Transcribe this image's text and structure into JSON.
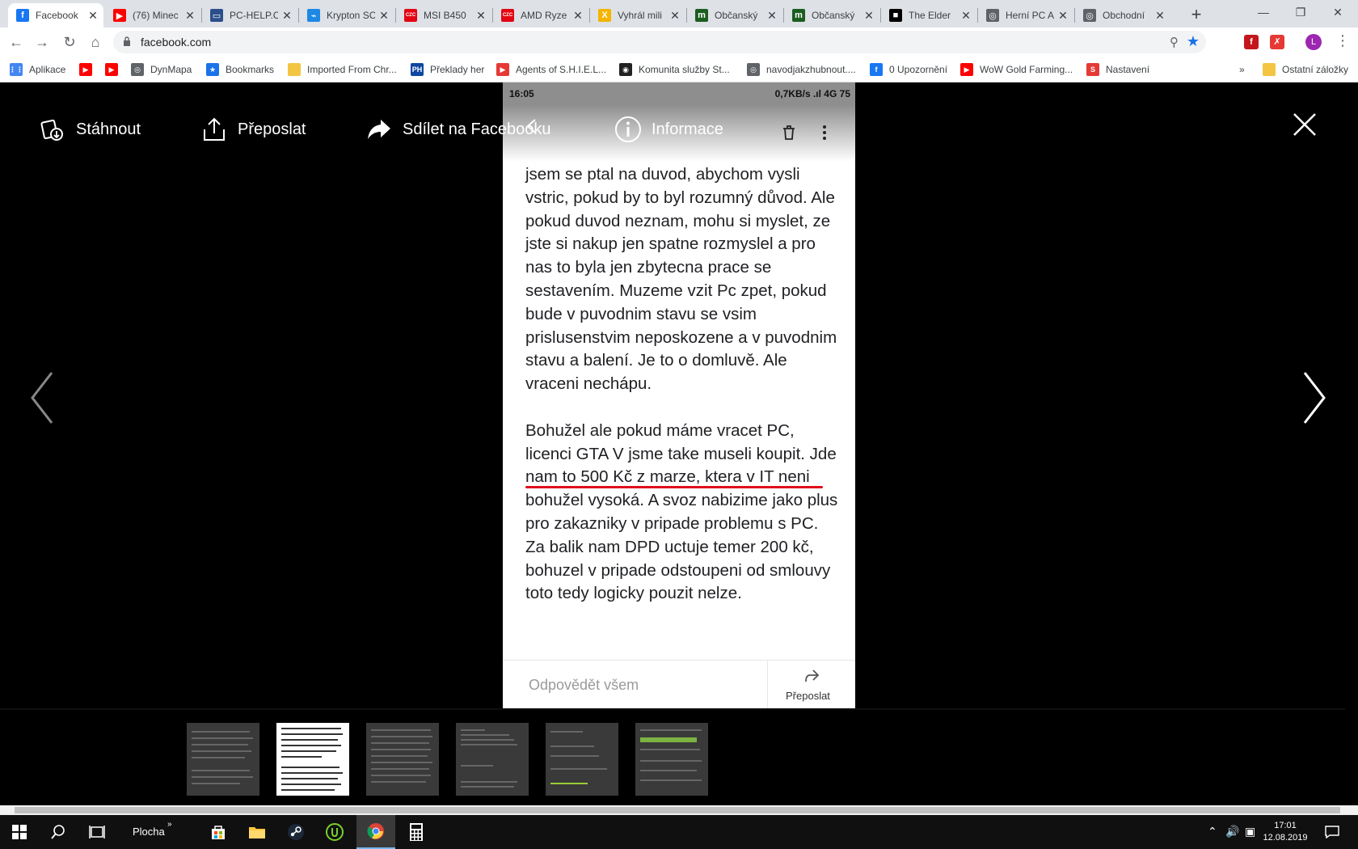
{
  "browser": {
    "tabs": [
      {
        "title": "Facebook",
        "icon": "facebook-icon",
        "icon_color": "#1877f2",
        "icon_text": "f",
        "active": true
      },
      {
        "title": "(76) Minec",
        "icon": "youtube-icon",
        "icon_color": "#ff0000",
        "icon_text": "▶"
      },
      {
        "title": "PC-HELP.C",
        "icon": "monitor-icon",
        "icon_color": "#2b4f8a",
        "icon_text": "▭"
      },
      {
        "title": "Krypton SC",
        "icon": "krypton-icon",
        "icon_color": "#1e88e5",
        "icon_text": "⌁"
      },
      {
        "title": "MSI B450",
        "icon": "czc-icon",
        "icon_color": "#e30613",
        "icon_text": "CZC"
      },
      {
        "title": "AMD Ryze",
        "icon": "czc-icon",
        "icon_color": "#e30613",
        "icon_text": "CZC"
      },
      {
        "title": "Vyhrál mili",
        "icon": "x-icon",
        "icon_color": "#f5b400",
        "icon_text": "X"
      },
      {
        "title": "Občanský",
        "icon": "m-icon",
        "icon_color": "#1b5e20",
        "icon_text": "m"
      },
      {
        "title": "Občanský",
        "icon": "m-icon",
        "icon_color": "#1b5e20",
        "icon_text": "m"
      },
      {
        "title": "The Elder",
        "icon": "elder-icon",
        "icon_color": "#000000",
        "icon_text": "■"
      },
      {
        "title": "Herní PC A",
        "icon": "globe-icon",
        "icon_color": "#5f6368",
        "icon_text": "◎"
      },
      {
        "title": "Obchodní",
        "icon": "globe-icon",
        "icon_color": "#5f6368",
        "icon_text": "◎"
      }
    ],
    "url": "facebook.com",
    "profile_letter": "L",
    "bookmarks": [
      {
        "label": "Aplikace",
        "icon": "apps-grid-icon",
        "color": "#4285f4",
        "text": "⋮⋮"
      },
      {
        "label": "",
        "icon": "youtube-icon",
        "color": "#ff0000",
        "text": "▶"
      },
      {
        "label": "",
        "icon": "youtube-icon",
        "color": "#ff0000",
        "text": "▶"
      },
      {
        "label": "DynMapa",
        "icon": "globe-icon",
        "color": "#5f6368",
        "text": "◎"
      },
      {
        "label": "Bookmarks",
        "icon": "star-icon",
        "color": "#1a73e8",
        "text": "★"
      },
      {
        "label": "Imported From Chr...",
        "icon": "folder-icon",
        "color": "#f4c542",
        "text": ""
      },
      {
        "label": "Překlady her",
        "icon": "ph-icon",
        "color": "#0d47a1",
        "text": "PH"
      },
      {
        "label": "Agents of S.H.I.E.L...",
        "icon": "play-icon",
        "color": "#e53935",
        "text": "▶"
      },
      {
        "label": "Komunita služby St...",
        "icon": "steam-icon",
        "color": "#222222",
        "text": "◉"
      },
      {
        "label": "navodjakzhubnout....",
        "icon": "globe-icon",
        "color": "#5f6368",
        "text": "◎"
      },
      {
        "label": "0 Upozornění",
        "icon": "facebook-icon",
        "color": "#1877f2",
        "text": "f"
      },
      {
        "label": "WoW Gold Farming...",
        "icon": "youtube-icon",
        "color": "#ff0000",
        "text": "▶"
      },
      {
        "label": "Nastavení",
        "icon": "settings-icon",
        "color": "#e53935",
        "text": "S"
      }
    ],
    "bookmarks_overflow": "»",
    "other_bookmarks": "Ostatní záložky"
  },
  "viewer": {
    "download": "Stáhnout",
    "forward": "Přeposlat",
    "share": "Sdílet na Facebooku",
    "info": "Informace",
    "phone": {
      "time": "16:05",
      "network": "0,7KB/s .ıl 4G 75",
      "paragraph1": "jsem se ptal na duvod, abychom vysli vstric, pokud by to byl rozumný důvod. Ale pokud duvod neznam, mohu si myslet, ze jste si nakup jen spatne rozmyslel a pro nas to byla jen zbytecna prace se sestavením. Muzeme vzit Pc zpet, pokud bude v puvodnim stavu se vsim prislusenstvim neposkozene a v puvodnim stavu a balení. Je to o domluvě. Ale vraceni nechápu.",
      "paragraph2": "Bohužel ale pokud máme vracet PC, licenci GTA V jsme take museli koupit. Jde nam to 500 Kč z marze, ktera v IT neni bohužel vysoká. A svoz nabizime jako plus pro zakazniky v pripade problemu s PC. Za balik nam DPD uctuje temer 200 kč, bohuzel v pripade odstoupeni od smlouvy toto tedy logicky pouzit nelze.",
      "reply_all": "Odpovědět všem",
      "forward": "Přeposlat"
    }
  },
  "taskbar": {
    "desktop_label": "Plocha",
    "desktop_arrow": "»",
    "time": "17:01",
    "date": "12.08.2019"
  }
}
